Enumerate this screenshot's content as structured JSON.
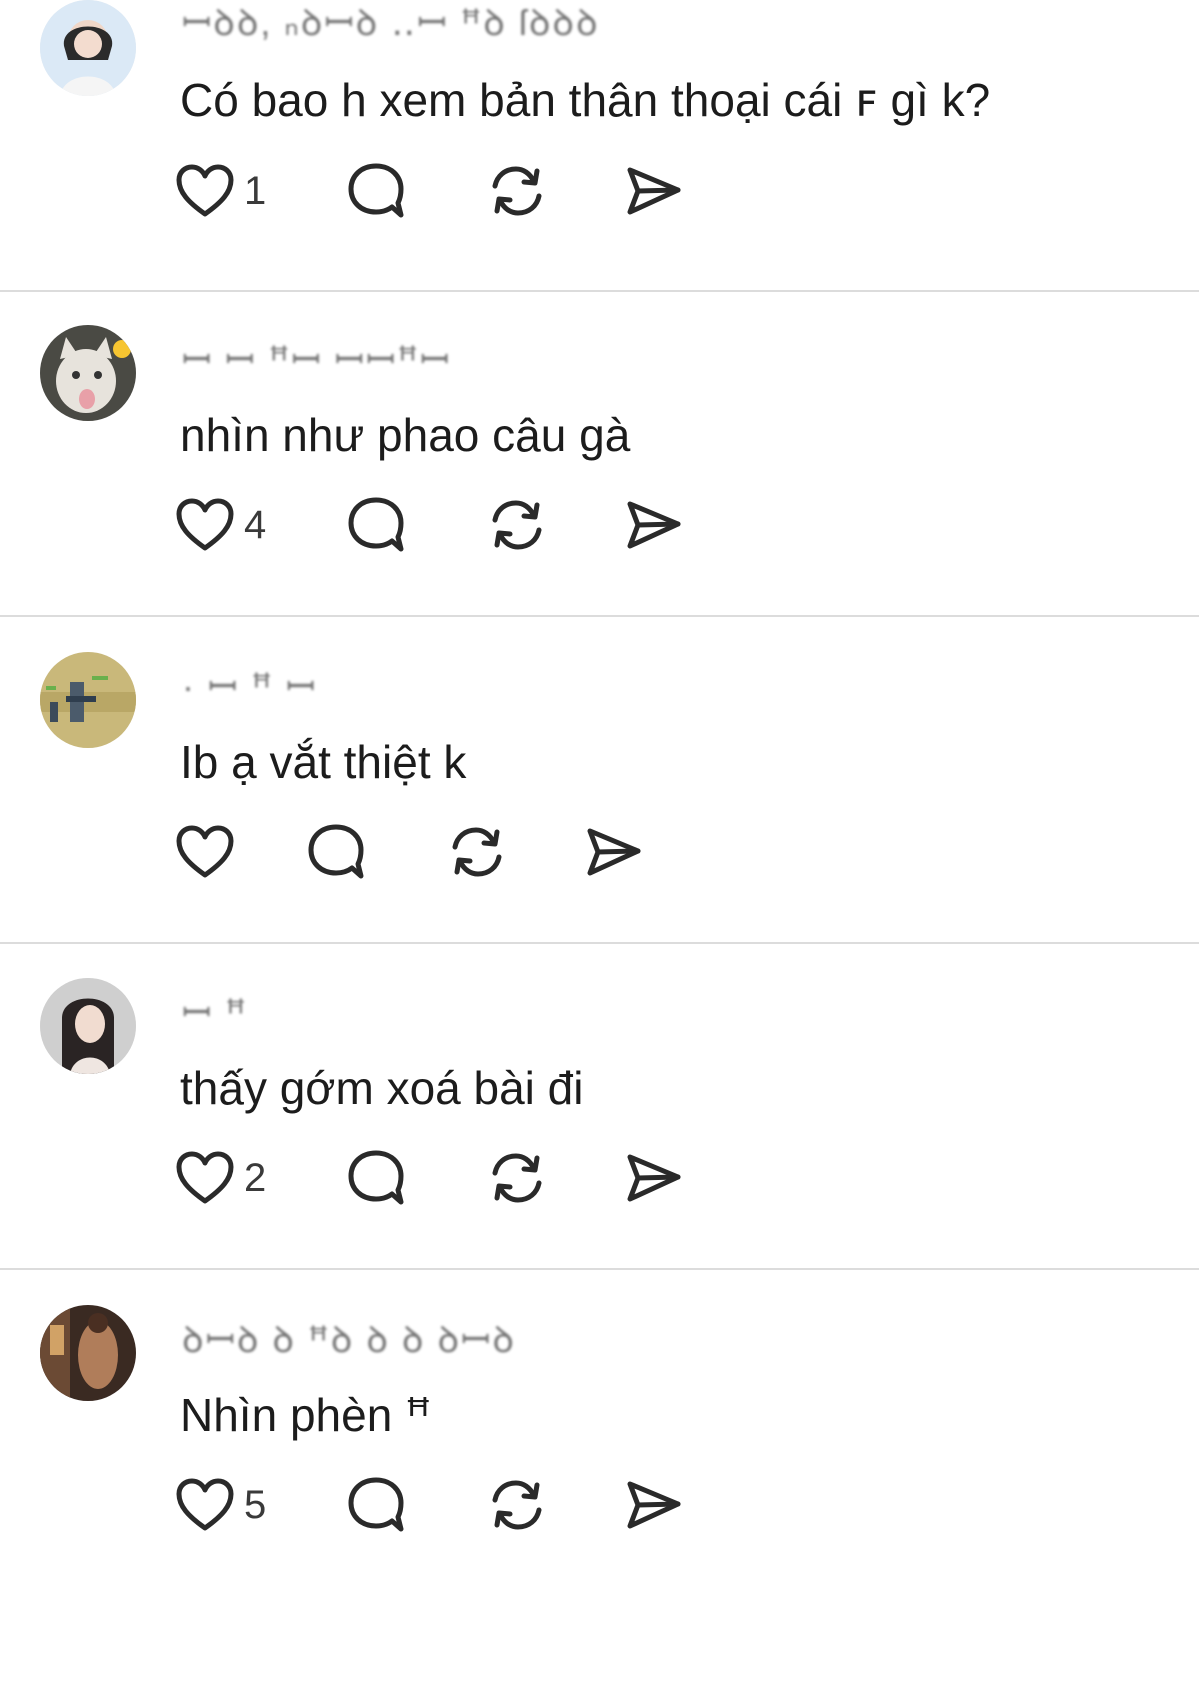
{
  "comments": [
    {
      "username": "ꟷꝺꝺ, ₙꝺꟷꝺ ‥ꟷ ꟸꝺ ſꝺꝺꝺ",
      "text": "Có bao h xem bản thân thoại cái ꜰ gì k?",
      "likes": "1",
      "avatar_icon": "avatar-girl-photo"
    },
    {
      "username": "ꟷ ꟷ ꟸꟷ ꟷꟷꟸꟷ",
      "text": "nhìn như phao câu gà",
      "likes": "4",
      "avatar_icon": "avatar-cat-photo"
    },
    {
      "username": "· ꟷ ꟸ ꟷ",
      "text": "Ib ạ vắt thiệt k",
      "likes": "",
      "avatar_icon": "avatar-game-character"
    },
    {
      "username": "ꟷ ꟸ",
      "text": "thấy gớm xoá bài đi",
      "likes": "2",
      "avatar_icon": "avatar-woman-photo"
    },
    {
      "username": "ꝺꟷꝺ ꝺ ꟸꝺ ꝺ ꝺ ꝺꟷꝺ",
      "text": "Nhìn phèn ꟸ",
      "likes": "5",
      "avatar_icon": "avatar-dark-photo"
    }
  ],
  "colors": {
    "icon_stroke": "#2a2a2a",
    "divider": "#dcdcdc",
    "text": "#1c1c1c"
  }
}
